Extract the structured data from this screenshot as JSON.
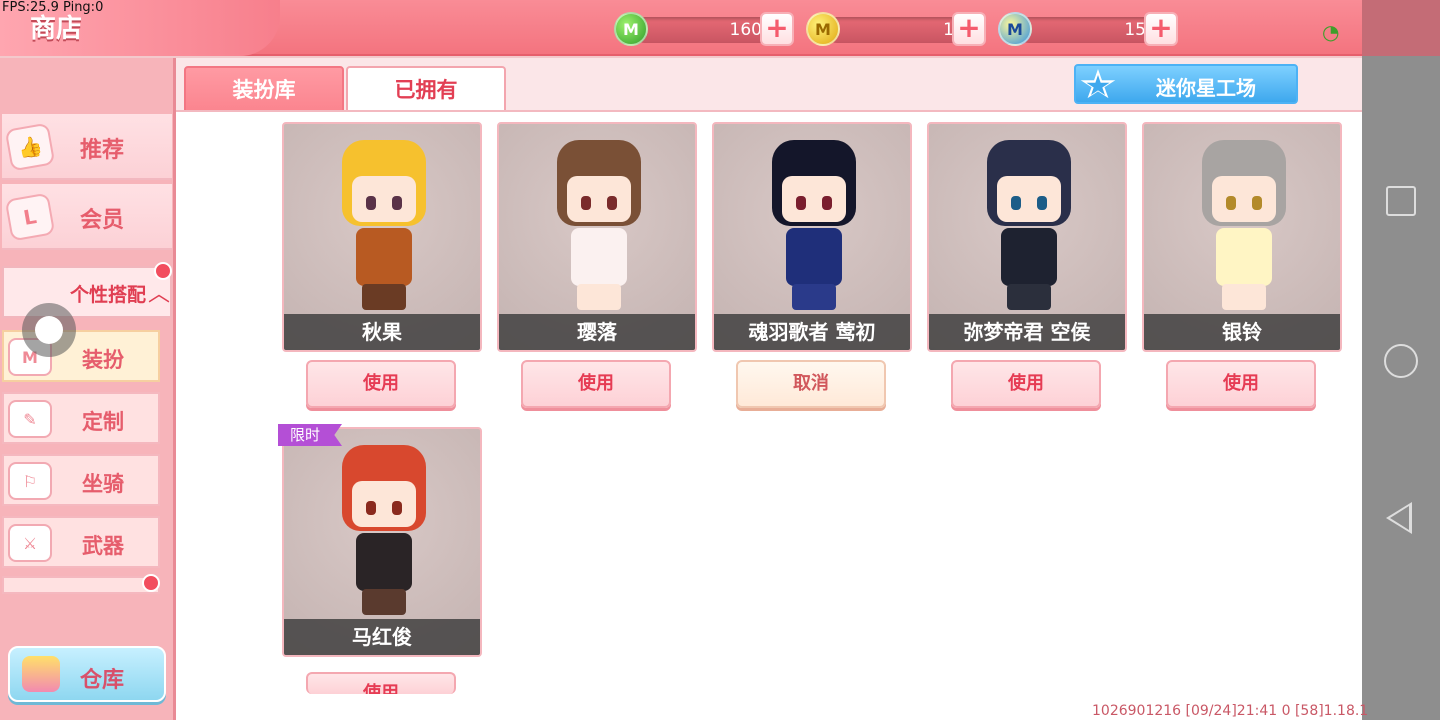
{
  "debug": {
    "fps_text": "FPS:25.9  Ping:0"
  },
  "header": {
    "title": "商店"
  },
  "currencies": [
    {
      "icon": "green-mini-coin-icon",
      "value": "160"
    },
    {
      "icon": "gold-mini-coin-icon",
      "value": "1"
    },
    {
      "icon": "blue-mini-coin-icon",
      "value": "15"
    }
  ],
  "sidebar": {
    "recommend": "推荐",
    "member": "会员",
    "personal_style": "个性搭配",
    "sub_items": [
      {
        "label": "装扮",
        "icon_text": "M"
      },
      {
        "label": "定制",
        "icon_text": "✎"
      },
      {
        "label": "坐骑",
        "icon_text": "⚐"
      },
      {
        "label": "武器",
        "icon_text": "⚔"
      }
    ],
    "storage": "仓库"
  },
  "tabs": {
    "dress_library": "装扮库",
    "owned": "已拥有"
  },
  "workshop_label": "迷你星工场",
  "items": [
    {
      "name": "秋果",
      "button": "使用"
    },
    {
      "name": "璎落",
      "button": "使用"
    },
    {
      "name": "魂羽歌者 莺初",
      "button": "取消"
    },
    {
      "name": "弥梦帝君 空侯",
      "button": "使用"
    },
    {
      "name": "银铃",
      "button": "使用"
    },
    {
      "name": "马红俊",
      "button": "使用",
      "tag": "限时"
    }
  ],
  "footer": {
    "info": "1026901216   [09/24]21:41 0   [58]1.18.1"
  }
}
